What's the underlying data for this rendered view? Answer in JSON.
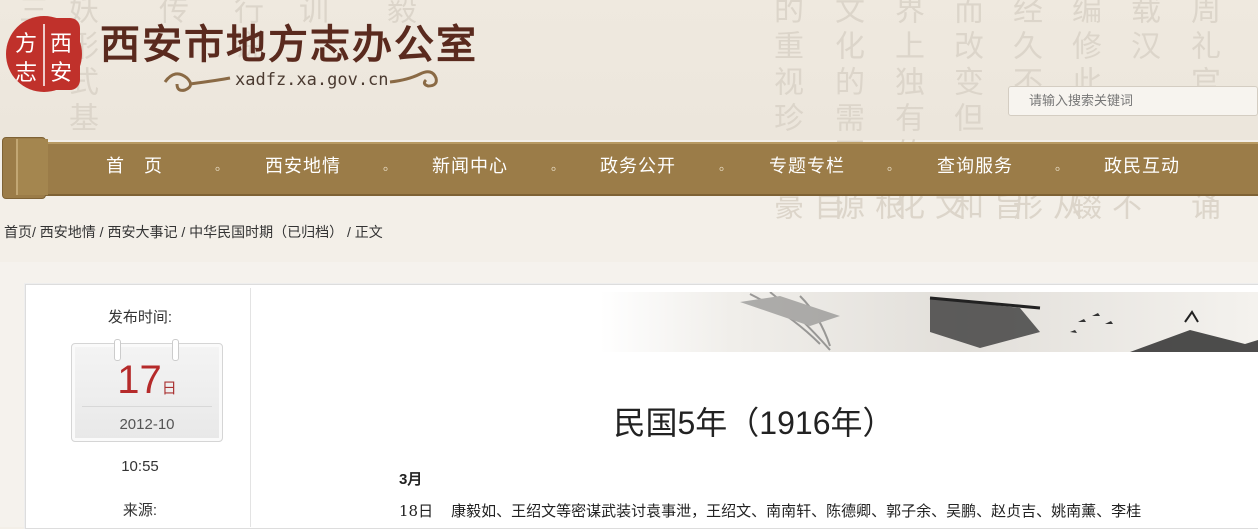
{
  "header": {
    "site_title": "西安市地方志办公室",
    "domain": "xadfz.xa.gov.cn",
    "seal_chars": [
      "西",
      "安",
      "方",
      "志"
    ],
    "search_placeholder": "请输入搜索关键词"
  },
  "background_text": [
    "妖",
    "形式",
    "基",
    "传",
    "行",
    "说",
    "训",
    "毅",
    "的重视",
    "珍",
    "文化的需要",
    "界上独有的",
    "而改变",
    "但",
    "经久不",
    "编修",
    "此",
    "载",
    "汉",
    "周礼",
    "官",
    "自豪",
    "根源",
    "文化",
    "旨和",
    "从形",
    "不辍",
    "诵"
  ],
  "nav": {
    "items": [
      "首　页",
      "西安地情",
      "新闻中心",
      "政务公开",
      "专题专栏",
      "查询服务",
      "政民互动"
    ],
    "separator": "。"
  },
  "breadcrumb": {
    "items": [
      "首页",
      "西安地情",
      "西安大事记",
      "中华民国时期（已归档）",
      "正文"
    ],
    "separators": [
      "/ ",
      " / ",
      " / ",
      " / "
    ]
  },
  "sidebar": {
    "publish_label": "发布时间:",
    "day": "17",
    "day_suffix": "日",
    "year_month": "2012-10",
    "time": "10:55",
    "source_label": "来源:"
  },
  "article": {
    "title": "民国5年（1916年）",
    "month": "3月",
    "entry_day": "18日",
    "entry_text": "康毅如、王绍文等密谋武装讨袁事泄，王绍文、南南轩、陈德卿、郭子余、吴鹏、赵贞吉、姚南薰、李桂"
  },
  "colors": {
    "nav_bg": "#9b7c48",
    "title_color": "#5a2a1e",
    "day_color": "#b52a2a",
    "seal_red": "#c0312b"
  }
}
